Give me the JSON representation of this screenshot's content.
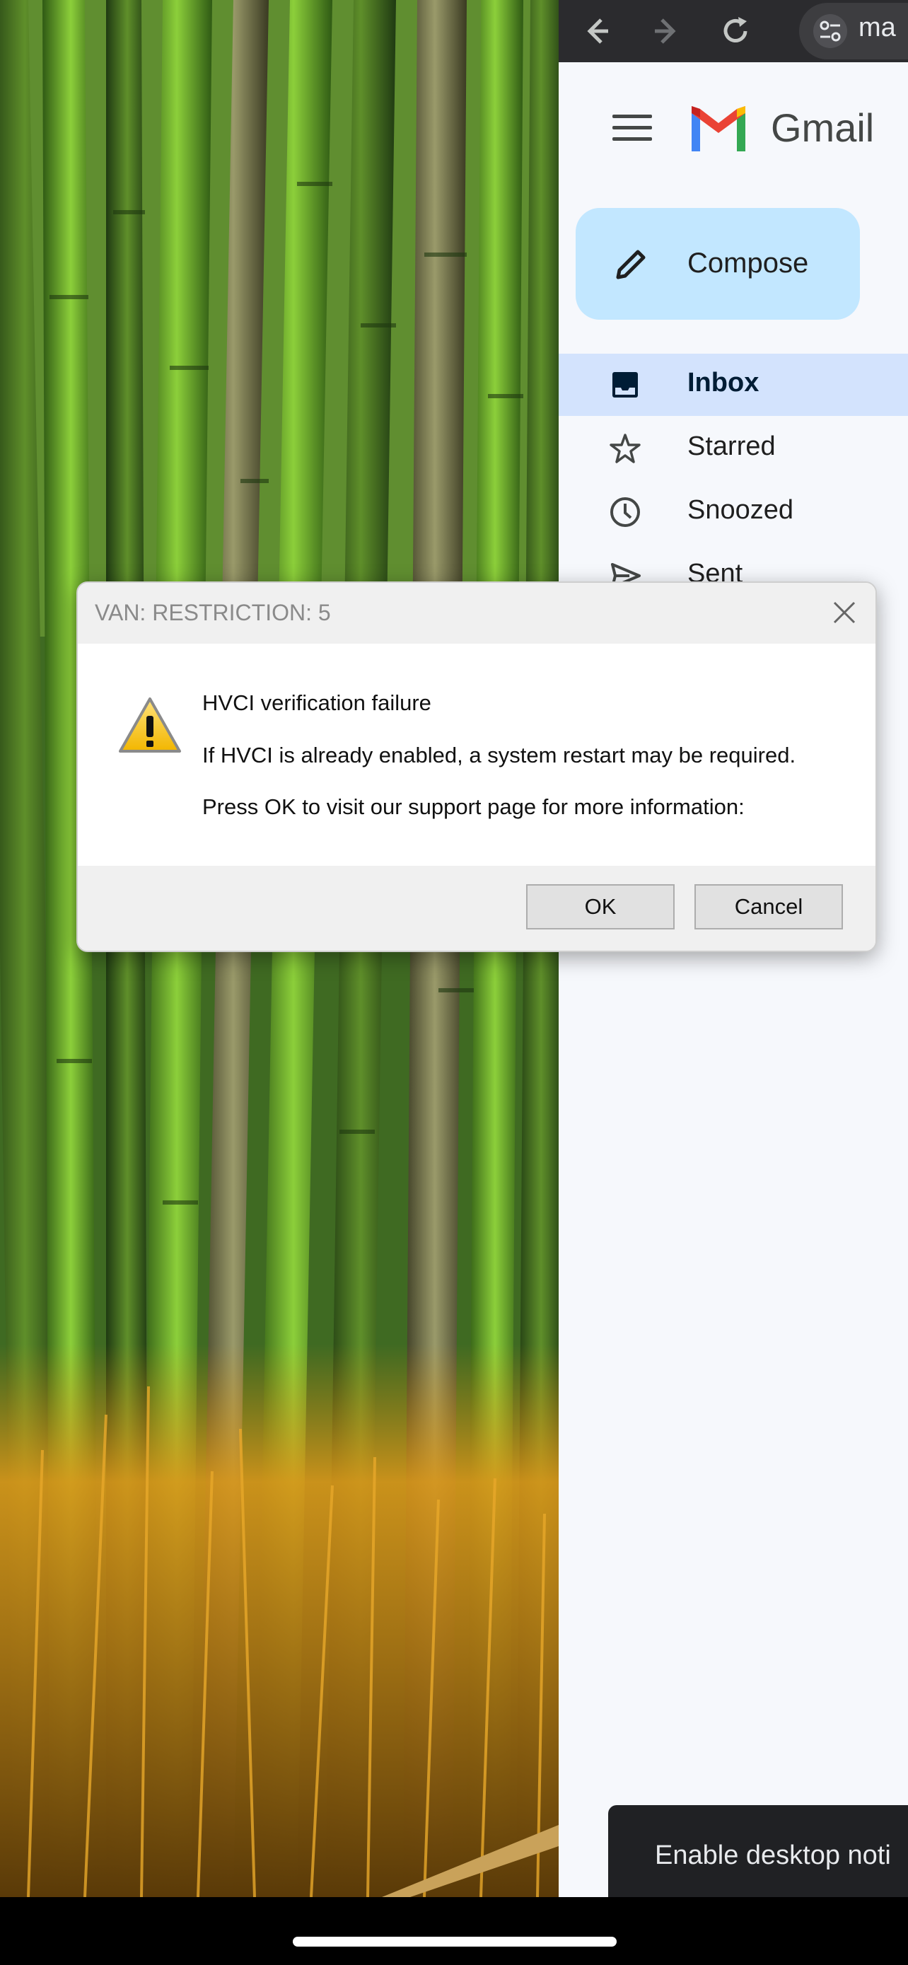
{
  "browser": {
    "url_partial": "ma",
    "icons": [
      "back-arrow-icon",
      "forward-arrow-icon",
      "reload-icon",
      "site-settings-icon"
    ]
  },
  "gmail": {
    "title": "Gmail",
    "compose_label": "Compose",
    "nav": [
      {
        "label": "Inbox",
        "icon": "inbox-icon",
        "selected": true
      },
      {
        "label": "Starred",
        "icon": "star-icon",
        "selected": false
      },
      {
        "label": "Snoozed",
        "icon": "clock-icon",
        "selected": false
      },
      {
        "label": "Sent",
        "icon": "send-icon",
        "selected": false
      }
    ],
    "toast": "Enable desktop noti"
  },
  "dialog": {
    "title": "VAN: RESTRICTION: 5",
    "heading": "HVCI verification failure",
    "line2": "If HVCI is already enabled, a system restart may be required.",
    "line3": "Press OK to visit our support page for more information:",
    "ok_label": "OK",
    "cancel_label": "Cancel",
    "icon": "warning-icon"
  },
  "colors": {
    "compose_bg": "#c2e7ff",
    "inbox_selected_bg": "#d3e3fd",
    "panel_bg": "#f6f8fc",
    "toolbar_bg": "#2b2b2e"
  }
}
